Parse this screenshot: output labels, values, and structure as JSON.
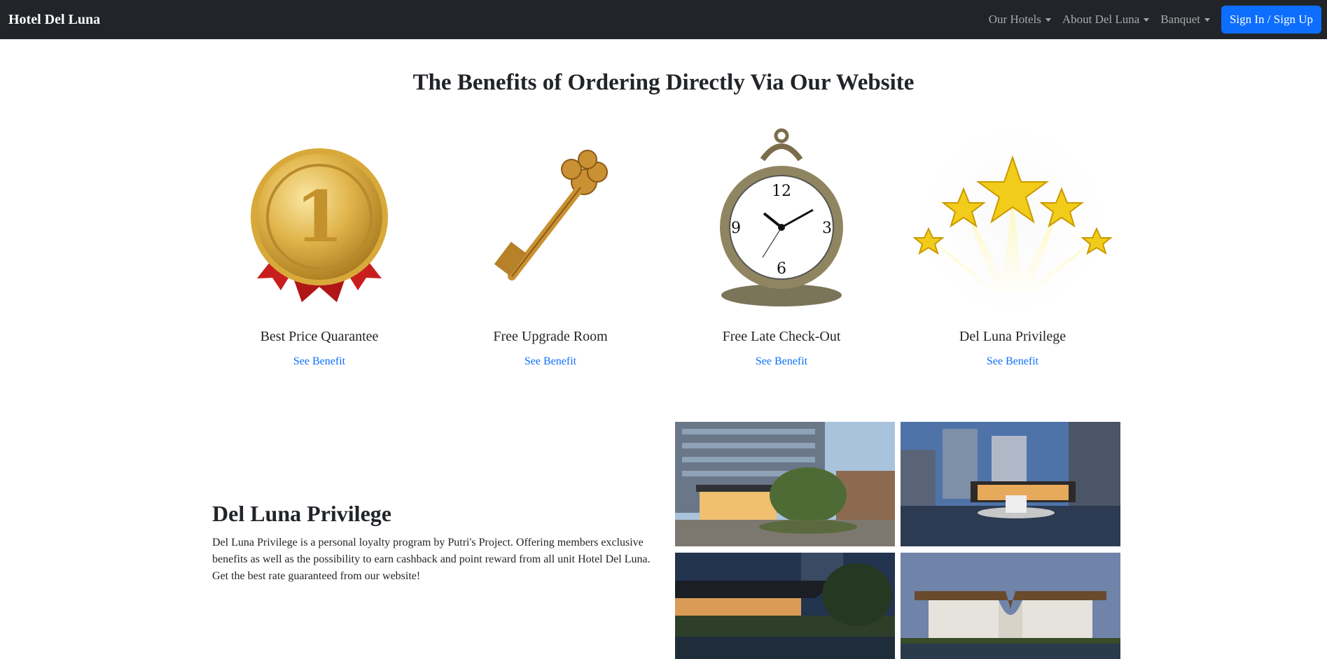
{
  "navbar": {
    "brand": "Hotel Del Luna",
    "items": [
      {
        "label": "Our Hotels"
      },
      {
        "label": "About Del Luna"
      },
      {
        "label": "Banquet"
      }
    ],
    "signin_label": "Sign In / Sign Up"
  },
  "benefits": {
    "heading": "The Benefits of Ordering Directly Via Our Website",
    "cards": [
      {
        "title": "Best Price Quarantee",
        "link": "See Benefit",
        "icon": "gold-medal-icon"
      },
      {
        "title": "Free Upgrade Room",
        "link": "See Benefit",
        "icon": "golden-key-icon"
      },
      {
        "title": "Free Late Check-Out",
        "link": "See Benefit",
        "icon": "pocket-watch-icon"
      },
      {
        "title": "Del Luna Privilege",
        "link": "See Benefit",
        "icon": "stars-icon"
      }
    ]
  },
  "privilege": {
    "title": "Del Luna Privilege",
    "text": "Del Luna Privilege is a personal loyalty program by Putri's Project. Offering members exclusive benefits as well as the possibility to earn cashback and point reward from all unit Hotel Del Luna. Get the best rate guaranteed from our website!"
  },
  "colors": {
    "navbar_bg": "#212529",
    "primary": "#0d6efd",
    "gold": "#d4a934"
  }
}
